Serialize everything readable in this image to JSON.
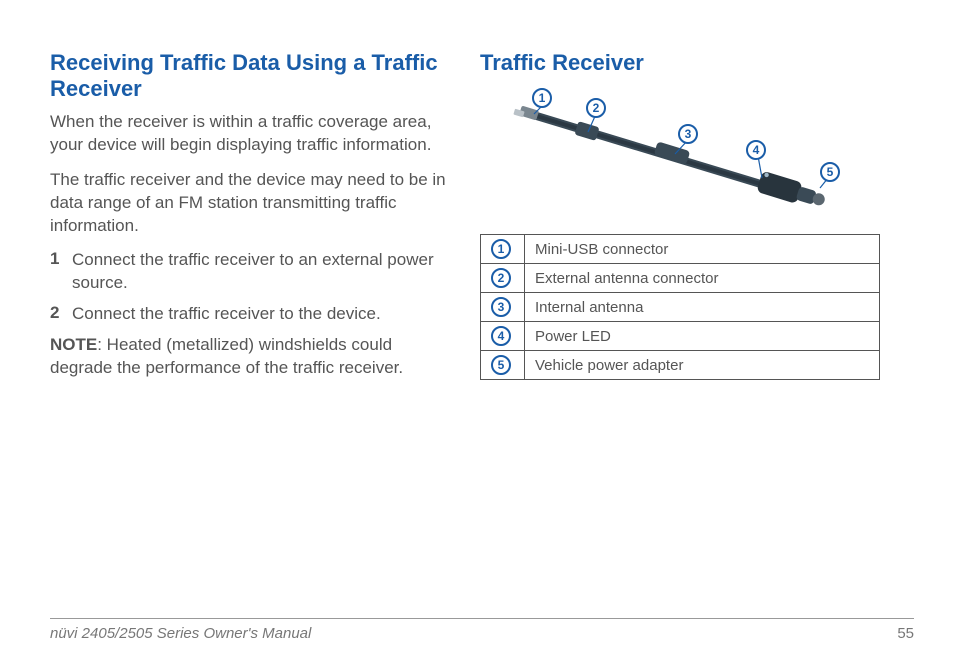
{
  "left": {
    "heading": "Receiving Traffic Data Using a Traffic Receiver",
    "para1": "When the receiver is within a traffic coverage area, your device will begin displaying traffic information.",
    "para2": "The traffic receiver and the device may need to be in data range of an FM station transmitting traffic information.",
    "steps": [
      {
        "n": "1",
        "t": "Connect the traffic receiver to an external power source."
      },
      {
        "n": "2",
        "t": "Connect the traffic receiver to the device."
      }
    ],
    "note_label": "NOTE",
    "note_text": ": Heated (metallized) windshields could degrade the performance of the traffic receiver."
  },
  "right": {
    "heading": "Traffic Receiver",
    "callouts": [
      "1",
      "2",
      "3",
      "4",
      "5"
    ],
    "parts": [
      {
        "n": "1",
        "label": "Mini-USB connector"
      },
      {
        "n": "2",
        "label": "External antenna connector"
      },
      {
        "n": "3",
        "label": "Internal antenna"
      },
      {
        "n": "4",
        "label": "Power LED"
      },
      {
        "n": "5",
        "label": "Vehicle power adapter"
      }
    ]
  },
  "footer": {
    "manual": "nüvi 2405/2505 Series Owner's Manual",
    "page": "55"
  }
}
